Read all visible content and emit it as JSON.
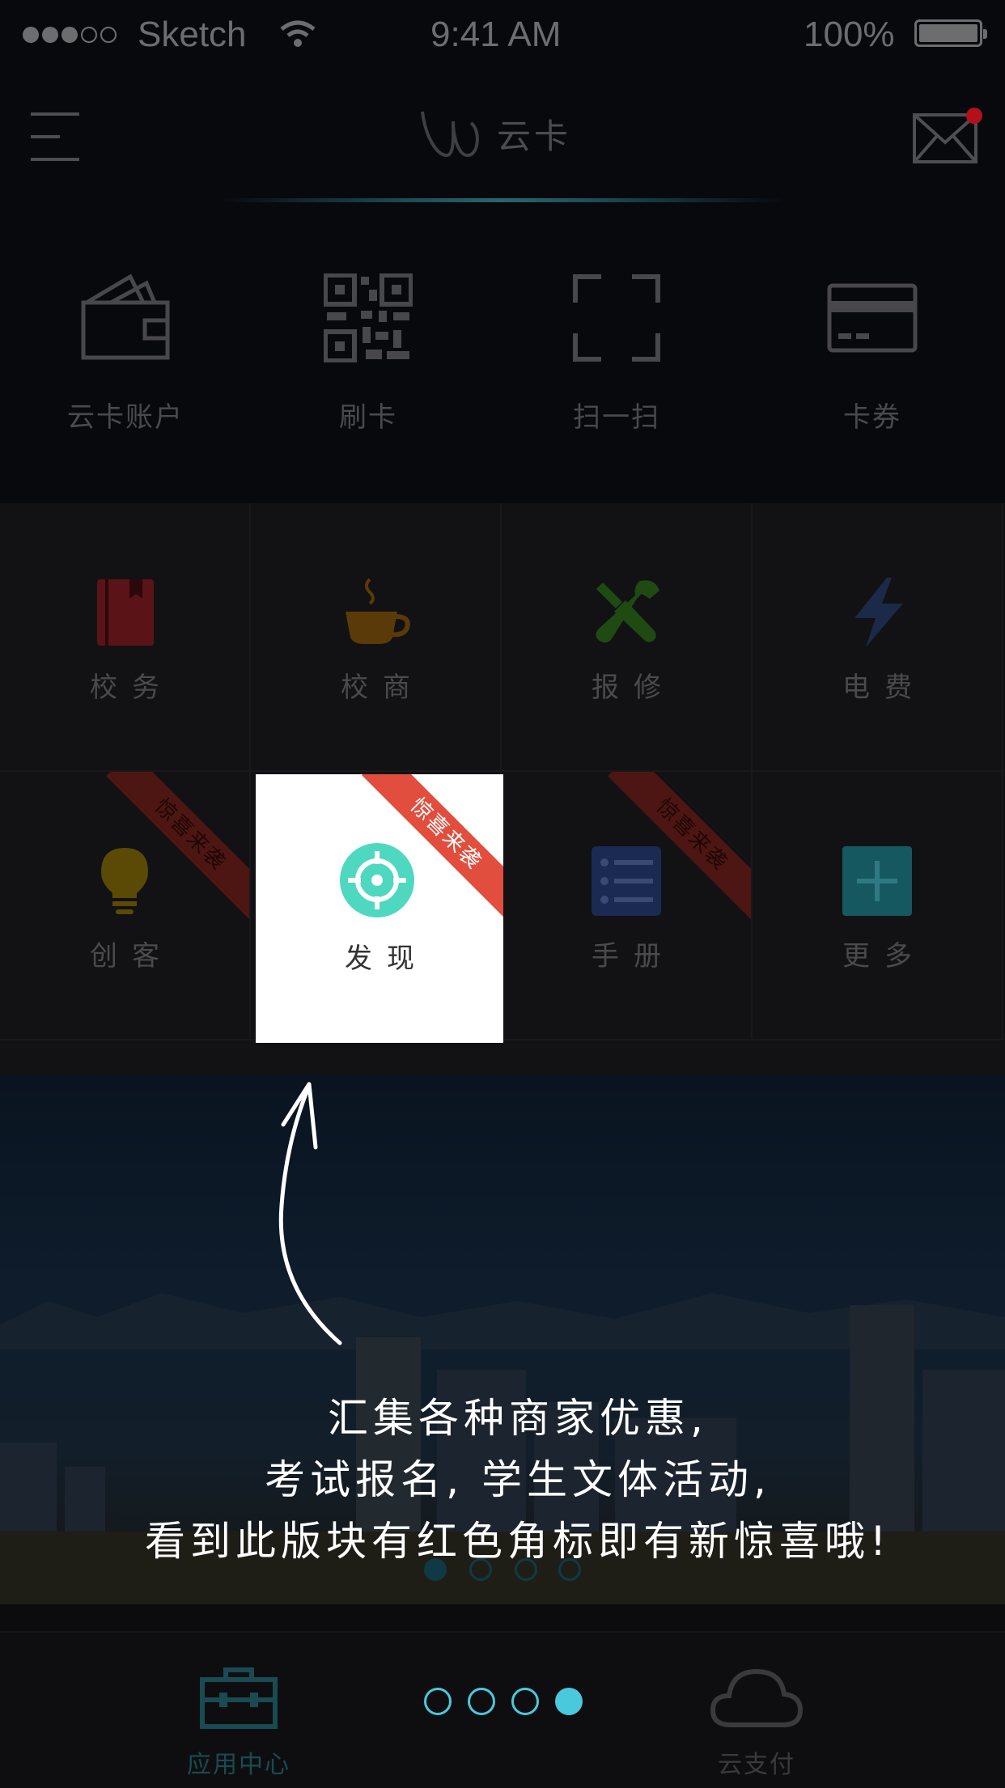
{
  "status_bar": {
    "carrier": "Sketch",
    "time": "9:41 AM",
    "battery": "100%"
  },
  "header": {
    "app_name": "云卡"
  },
  "quick_actions": [
    {
      "label": "云卡账户",
      "icon": "wallet-icon"
    },
    {
      "label": "刷卡",
      "icon": "qr-code-icon"
    },
    {
      "label": "扫一扫",
      "icon": "scan-icon"
    },
    {
      "label": "卡券",
      "icon": "card-icon"
    }
  ],
  "grid": {
    "row1": [
      {
        "label": "校务",
        "icon": "book-icon",
        "color": "#5a1418"
      },
      {
        "label": "校商",
        "icon": "coffee-cup-icon",
        "color": "#5a3a08"
      },
      {
        "label": "报修",
        "icon": "tools-icon",
        "color": "#1f4a12"
      },
      {
        "label": "电费",
        "icon": "lightning-icon",
        "color": "#1a2a48"
      }
    ],
    "row2": [
      {
        "label": "创客",
        "icon": "bulb-icon",
        "color": "#5a4a06",
        "badge": "惊喜来袭"
      },
      {
        "label": "发现",
        "icon": "target-icon",
        "color": "#4fd8c0",
        "badge": "惊喜来袭"
      },
      {
        "label": "手册",
        "icon": "list-icon",
        "color": "#1a2a52",
        "badge": "惊喜来袭"
      },
      {
        "label": "更多",
        "icon": "plus-icon",
        "color": "#155860"
      }
    ]
  },
  "annotation": {
    "line1": "汇集各种商家优惠,",
    "line2": "考试报名, 学生文体活动,",
    "line3": "看到此版块有红色角标即有新惊喜哦!"
  },
  "banner": {
    "active_page": 1,
    "page_count": 4
  },
  "tour_pager": {
    "active_page": 4,
    "page_count": 4,
    "color": "#4ac8dc"
  },
  "tabs": [
    {
      "label": "应用中心",
      "icon": "toolbox-icon",
      "color": "#1a4a52"
    },
    {
      "label": "云支付",
      "icon": "cloud-icon",
      "color": "#3a3a3e"
    }
  ]
}
